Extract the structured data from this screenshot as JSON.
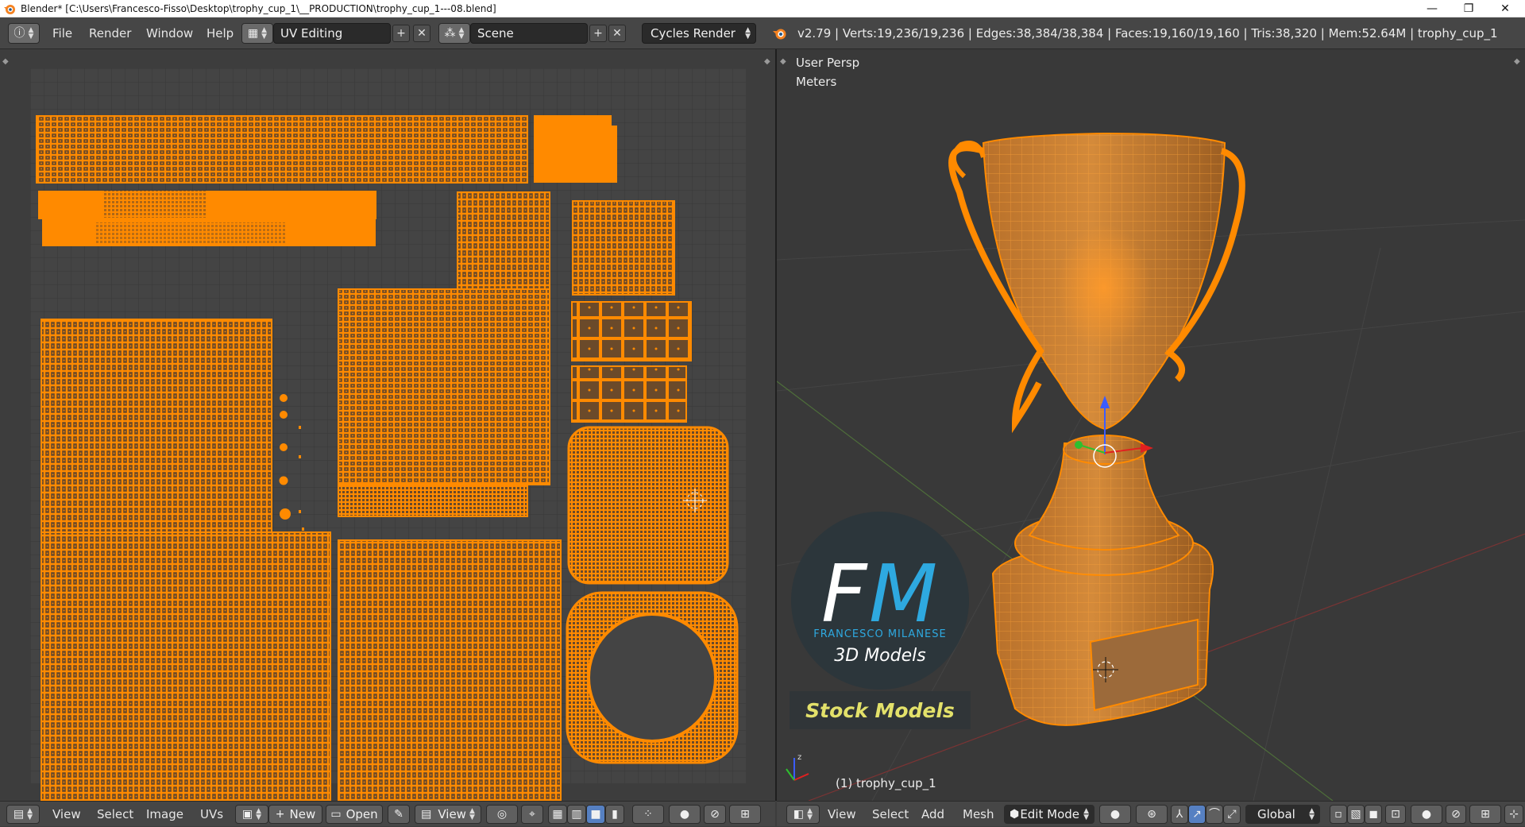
{
  "window": {
    "title": "Blender* [C:\\Users\\Francesco-Fisso\\Desktop\\trophy_cup_1\\__PRODUCTION\\trophy_cup_1---08.blend]",
    "app_icon": "blender-icon",
    "minimize_glyph": "—",
    "maximize_glyph": "❐",
    "close_glyph": "✕"
  },
  "topbar": {
    "menus": [
      "File",
      "Render",
      "Window",
      "Help"
    ],
    "screen_layout": "UV Editing",
    "scene": "Scene",
    "render_engine": "Cycles Render",
    "stats": "v2.79 | Verts:19,236/19,236 | Edges:38,384/38,384 | Faces:19,160/19,160 | Tris:38,320 | Mem:52.64M | trophy_cup_1",
    "add_glyph": "+",
    "remove_glyph": "✕"
  },
  "viewport": {
    "view_name": "User Persp",
    "units": "Meters",
    "object_label": "(1) trophy_cup_1"
  },
  "watermark": {
    "logo_letters_f": "F",
    "logo_letters_m": "M",
    "brand_name": "FRANCESCO MILANESE",
    "tagline": "3D Models",
    "badge": "Stock Models"
  },
  "uv_bottombar": {
    "menus": [
      "View",
      "Select",
      "Image",
      "UVs"
    ],
    "new_label": "New",
    "open_label": "Open",
    "view_label": "View"
  },
  "vp_bottombar": {
    "menus": [
      "View",
      "Select",
      "Add",
      "Mesh"
    ],
    "mode": "Edit Mode",
    "orientation": "Global"
  },
  "colors": {
    "uv_orange": "#ff8a00",
    "header_bg": "#464646",
    "editor_bg": "#3d3d3d",
    "active_button": "#5680c2",
    "logo_blue": "#2ea9e0",
    "badge_text": "#e3e16a"
  }
}
